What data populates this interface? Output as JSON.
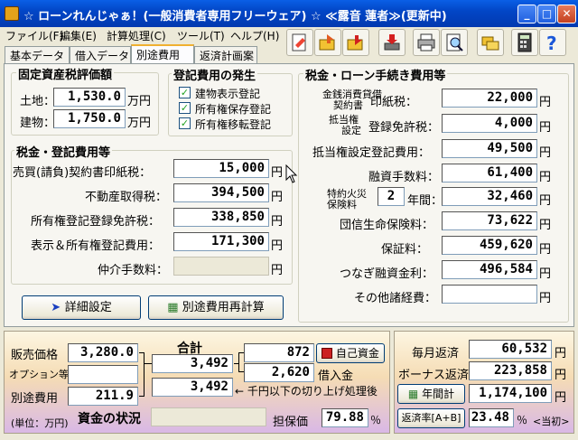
{
  "window": {
    "title": "☆ ローンれんじゃぁ！(一般消費者専用フリーウェア) ☆ ≪露音 蓮者≫(更新中)"
  },
  "menu": [
    "ファイル(F)",
    "編集(E)",
    "計算処理(C)",
    "ツール(T)",
    "ヘルプ(H)"
  ],
  "tabs": [
    "基本データ",
    "借入データ",
    "別途費用",
    "返済計画案"
  ],
  "toolbar_icons": [
    "new-icon",
    "open-icon",
    "save-icon",
    "import-icon",
    "print-icon",
    "print-preview-icon",
    "folder-icon",
    "calculator-icon",
    "help-icon"
  ],
  "fixed_asset": {
    "title": "固定資産税評価額",
    "land_label": "土地：",
    "land_value": "1,530.0",
    "land_unit": "万円",
    "building_label": "建物：",
    "building_value": "1,750.0",
    "building_unit": "万円"
  },
  "registration": {
    "title": "登記費用の発生",
    "items": [
      "建物表示登記",
      "所有権保存登記",
      "所有権移転登記"
    ]
  },
  "tax_reg": {
    "title": "税金・登記費用等",
    "rows": [
      {
        "label": "売買(請負)契約書印紙税：",
        "value": "15,000",
        "unit": "円"
      },
      {
        "label": "不動産取得税：",
        "value": "394,500",
        "unit": "円"
      },
      {
        "label": "所有権登記登録免許税：",
        "value": "338,850",
        "unit": "円"
      },
      {
        "label": "表示＆所有権登記費用：",
        "value": "171,300",
        "unit": "円"
      },
      {
        "label": "仲介手数料：",
        "value": "",
        "unit": "円"
      }
    ]
  },
  "buttons": {
    "detail": "詳細設定",
    "recalc": "別途費用再計算",
    "self_fund": "自己資金",
    "annual": "年間計",
    "ratio": "返済率[A+B]"
  },
  "loan_costs": {
    "title": "税金・ローン手続き費用等",
    "r1_label_a": "金銭消費貸借",
    "r1_label_b": "契約書",
    "r1_label_c": "印紙税：",
    "r1_value": "22,000",
    "r2_label_a": "抵当権",
    "r2_label_b": "設定",
    "r2_label_c": "登録免許税：",
    "r2_value": "4,000",
    "r3_label": "抵当権設定登記費用：",
    "r3_value": "49,500",
    "r4_label": "融資手数料：",
    "r4_value": "61,400",
    "r5_label_a": "特約火災",
    "r5_label_b": "保険料",
    "r5_years": "2",
    "r5_label_c": "年間：",
    "r5_value": "32,460",
    "r6_label": "団信生命保険料：",
    "r6_value": "73,622",
    "r7_label": "保証料：",
    "r7_value": "459,620",
    "r8_label": "つなぎ融資金利：",
    "r8_value": "496,584",
    "r9_label": "その他諸経費：",
    "r9_value": "",
    "unit": "円"
  },
  "funds": {
    "sale_label": "販売価格",
    "sale_value": "3,280.0",
    "option_label": "オプション等",
    "option_value": "",
    "extra_label": "別途費用",
    "extra_value": "211.9",
    "unit_note": "(単位：万円)",
    "status_title": "資金の状況",
    "total_label": "合計",
    "total1": "3,492",
    "total2": "3,492",
    "own": "872",
    "loan": "2,620",
    "loan_label": "借入金",
    "round_note": "← 千円以下の切り上げ処理後",
    "collateral_label": "担保価",
    "collateral_value": "79.88",
    "collateral_unit": "％"
  },
  "repay": {
    "monthly_label": "毎月返済",
    "monthly_value": "60,532",
    "bonus_label": "ボーナス返済",
    "bonus_value": "223,858",
    "annual_value": "1,174,100",
    "ratio_value": "23.48",
    "ratio_unit": "％",
    "unit": "円",
    "judge": "<当初>"
  }
}
